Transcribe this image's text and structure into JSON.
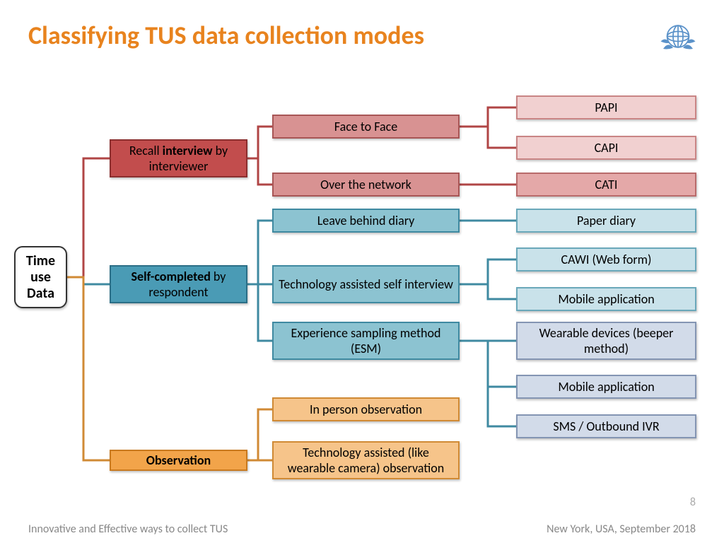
{
  "title": "Classifying TUS data collection modes",
  "root": "Time use Data",
  "level1": {
    "recall_html": "Recall <b>interview</b> by interviewer",
    "self_html": "<b>Self-completed</b> by respondent",
    "observation": "Observation"
  },
  "level2": {
    "r1": "Face to Face",
    "r2": "Over the network",
    "b1": "Leave behind diary",
    "b2": "Technology assisted self interview",
    "b3": "Experience sampling method (ESM)",
    "o1": "In person observation",
    "o2": "Technology assisted (like wearable camera) observation"
  },
  "level3": {
    "r1": "PAPI",
    "r2": "CAPI",
    "r3": "CATI",
    "b1": "Paper diary",
    "b2": "CAWI (Web form)",
    "b3": "Mobile application",
    "b4": "Wearable devices (beeper method)",
    "b5": "Mobile application",
    "b6": "SMS / Outbound IVR"
  },
  "footer": {
    "left": "Innovative and Effective ways to collect TUS",
    "right": "New York, USA,  September 2018"
  },
  "page": "8"
}
